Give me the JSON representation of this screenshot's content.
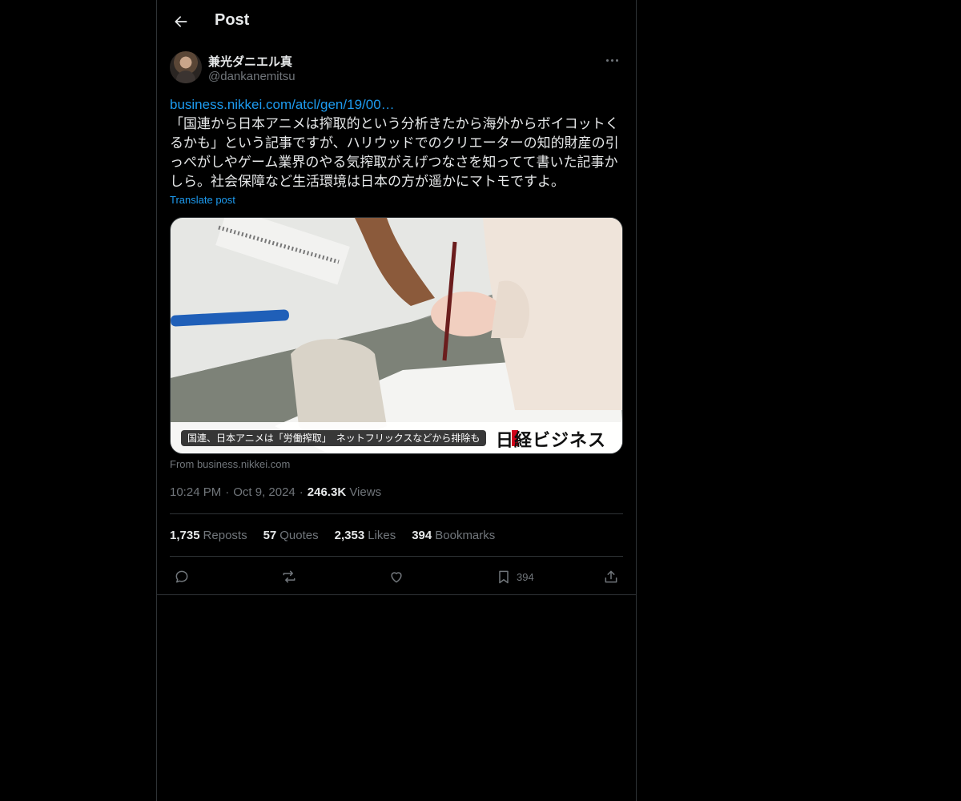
{
  "header": {
    "title": "Post"
  },
  "author": {
    "display_name": "兼光ダニエル真",
    "handle": "@dankanemitsu"
  },
  "post": {
    "link": "business.nikkei.com/atcl/gen/19/00…",
    "lines": [
      "「国連から日本アニメは搾取的という分析きたから海外からボイコットく",
      "るかも」という記事ですが、ハリウッドでのクリエーターの知的財産の引",
      "っぺがしやゲーム業界のやる気搾取がえげつなさを知ってて書いた記事か",
      "しら。社会保障など生活環境は日本の方が遥かにマトモですよ。"
    ],
    "translate_label": "Translate post"
  },
  "card": {
    "caption": "国連、日本アニメは「労働搾取」　ネットフリックスなどから排除も",
    "brand": "日経ビジネス",
    "source": "From business.nikkei.com"
  },
  "meta": {
    "time": "10:24 PM",
    "date": "Oct 9, 2024",
    "views_count": "246.3K",
    "views_label": "Views"
  },
  "stats": {
    "reposts": {
      "count": "1,735",
      "label": "Reposts"
    },
    "quotes": {
      "count": "57",
      "label": "Quotes"
    },
    "likes": {
      "count": "2,353",
      "label": "Likes"
    },
    "bookmarks": {
      "count": "394",
      "label": "Bookmarks"
    }
  },
  "actions": {
    "bookmark_count": "394"
  },
  "icons": [
    "back-arrow-icon",
    "more-icon",
    "reply-icon",
    "repost-icon",
    "like-icon",
    "bookmark-icon",
    "share-icon"
  ],
  "colors": {
    "background": "#000000",
    "text": "#e7e9ea",
    "muted": "#71767b",
    "link": "#1d9bf0",
    "border": "#2f3336"
  }
}
